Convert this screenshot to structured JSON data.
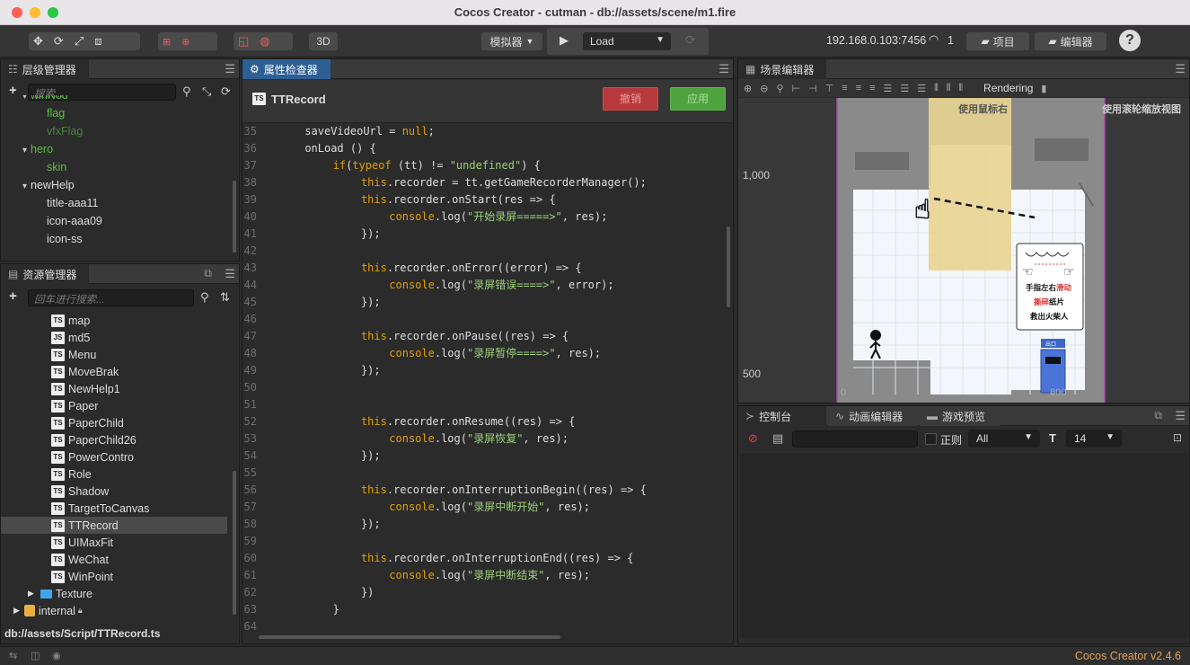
{
  "window": {
    "title": "Cocos Creator - cutman - db://assets/scene/m1.fire"
  },
  "toolbar": {
    "ip": "192.168.0.103:7456",
    "device_count": "1",
    "simulator_label": "模拟器",
    "load_label": "Load",
    "label_3d": "3D",
    "project_label": "项目",
    "editor_label": "编辑器"
  },
  "hierarchy": {
    "tab": "层级管理器",
    "search_placeholder": "搜索...",
    "nodes": [
      {
        "label": "winNod",
        "indent": 1,
        "arrow": true,
        "style": "green"
      },
      {
        "label": "flag",
        "indent": 2,
        "arrow": false,
        "style": "green"
      },
      {
        "label": "vfxFlag",
        "indent": 2,
        "arrow": false,
        "style": "dimgreen"
      },
      {
        "label": "hero",
        "indent": 1,
        "arrow": true,
        "style": "green"
      },
      {
        "label": "skin",
        "indent": 2,
        "arrow": false,
        "style": "green"
      },
      {
        "label": "newHelp",
        "indent": 1,
        "arrow": true,
        "style": "white"
      },
      {
        "label": "title-aaa11",
        "indent": 2,
        "arrow": false,
        "style": "white"
      },
      {
        "label": "icon-aaa09",
        "indent": 2,
        "arrow": false,
        "style": "white"
      },
      {
        "label": "icon-ss",
        "indent": 2,
        "arrow": false,
        "style": "white"
      }
    ]
  },
  "assets": {
    "tab": "资源管理器",
    "search_placeholder": "回车进行搜索...",
    "files": [
      {
        "badge": "TS",
        "name": "map"
      },
      {
        "badge": "JS",
        "name": "md5"
      },
      {
        "badge": "TS",
        "name": "Menu"
      },
      {
        "badge": "TS",
        "name": "MoveBrak"
      },
      {
        "badge": "TS",
        "name": "NewHelp1"
      },
      {
        "badge": "TS",
        "name": "Paper"
      },
      {
        "badge": "TS",
        "name": "PaperChild"
      },
      {
        "badge": "TS",
        "name": "PaperChild26"
      },
      {
        "badge": "TS",
        "name": "PowerContro"
      },
      {
        "badge": "TS",
        "name": "Role"
      },
      {
        "badge": "TS",
        "name": "Shadow"
      },
      {
        "badge": "TS",
        "name": "TargetToCanvas"
      },
      {
        "badge": "TS",
        "name": "TTRecord"
      },
      {
        "badge": "TS",
        "name": "UIMaxFit"
      },
      {
        "badge": "TS",
        "name": "WeChat"
      },
      {
        "badge": "TS",
        "name": "WinPoint"
      }
    ],
    "texture_folder": "Texture",
    "internal_folder": "internal",
    "path": "db://assets/Script/TTRecord.ts"
  },
  "inspector": {
    "tab": "属性检查器",
    "file_name": "TTRecord",
    "revert_label": "撤销",
    "apply_label": "应用",
    "lines": [
      {
        "n": "35",
        "indent": 4,
        "parts": [
          [
            "fn",
            "saveVideoUrl = "
          ],
          [
            "nul",
            "null"
          ],
          [
            "fn",
            ";"
          ]
        ]
      },
      {
        "n": "36",
        "indent": 4,
        "parts": [
          [
            "fn",
            "onLoad () {"
          ]
        ]
      },
      {
        "n": "37",
        "indent": 8,
        "parts": [
          [
            "kw",
            "if"
          ],
          [
            "fn",
            "("
          ],
          [
            "kw",
            "typeof"
          ],
          [
            "fn",
            " (tt) != "
          ],
          [
            "str",
            "\"undefined\""
          ],
          [
            "fn",
            ") {"
          ]
        ]
      },
      {
        "n": "38",
        "indent": 12,
        "parts": [
          [
            "kw",
            "this"
          ],
          [
            "fn",
            ".recorder = tt.getGameRecorderManager();"
          ]
        ]
      },
      {
        "n": "39",
        "indent": 12,
        "parts": [
          [
            "kw",
            "this"
          ],
          [
            "fn",
            ".recorder.onStart(res => {"
          ]
        ]
      },
      {
        "n": "40",
        "indent": 16,
        "parts": [
          [
            "kw",
            "console"
          ],
          [
            "fn",
            ".log("
          ],
          [
            "str",
            "\"开始录屏=====>\""
          ],
          [
            "fn",
            ", res);"
          ]
        ]
      },
      {
        "n": "41",
        "indent": 12,
        "parts": [
          [
            "fn",
            "});"
          ]
        ]
      },
      {
        "n": "42",
        "indent": 0,
        "parts": []
      },
      {
        "n": "43",
        "indent": 12,
        "parts": [
          [
            "kw",
            "this"
          ],
          [
            "fn",
            ".recorder.onError((error) => {"
          ]
        ]
      },
      {
        "n": "44",
        "indent": 16,
        "parts": [
          [
            "kw",
            "console"
          ],
          [
            "fn",
            ".log("
          ],
          [
            "str",
            "\"录屏错误====>\""
          ],
          [
            "fn",
            ", error);"
          ]
        ]
      },
      {
        "n": "45",
        "indent": 12,
        "parts": [
          [
            "fn",
            "});"
          ]
        ]
      },
      {
        "n": "46",
        "indent": 0,
        "parts": []
      },
      {
        "n": "47",
        "indent": 12,
        "parts": [
          [
            "kw",
            "this"
          ],
          [
            "fn",
            ".recorder.onPause((res) => {"
          ]
        ]
      },
      {
        "n": "48",
        "indent": 16,
        "parts": [
          [
            "kw",
            "console"
          ],
          [
            "fn",
            ".log("
          ],
          [
            "str",
            "\"录屏暂停====>\""
          ],
          [
            "fn",
            ", res);"
          ]
        ]
      },
      {
        "n": "49",
        "indent": 12,
        "parts": [
          [
            "fn",
            "});"
          ]
        ]
      },
      {
        "n": "50",
        "indent": 0,
        "parts": []
      },
      {
        "n": "51",
        "indent": 0,
        "parts": []
      },
      {
        "n": "52",
        "indent": 12,
        "parts": [
          [
            "kw",
            "this"
          ],
          [
            "fn",
            ".recorder.onResume((res) => {"
          ]
        ]
      },
      {
        "n": "53",
        "indent": 16,
        "parts": [
          [
            "kw",
            "console"
          ],
          [
            "fn",
            ".log("
          ],
          [
            "str",
            "\"录屏恢复\""
          ],
          [
            "fn",
            ", res);"
          ]
        ]
      },
      {
        "n": "54",
        "indent": 12,
        "parts": [
          [
            "fn",
            "});"
          ]
        ]
      },
      {
        "n": "55",
        "indent": 0,
        "parts": []
      },
      {
        "n": "56",
        "indent": 12,
        "parts": [
          [
            "kw",
            "this"
          ],
          [
            "fn",
            ".recorder.onInterruptionBegin((res) => {"
          ]
        ]
      },
      {
        "n": "57",
        "indent": 16,
        "parts": [
          [
            "kw",
            "console"
          ],
          [
            "fn",
            ".log("
          ],
          [
            "str",
            "\"录屏中断开始\""
          ],
          [
            "fn",
            ", res);"
          ]
        ]
      },
      {
        "n": "58",
        "indent": 12,
        "parts": [
          [
            "fn",
            "});"
          ]
        ]
      },
      {
        "n": "59",
        "indent": 0,
        "parts": []
      },
      {
        "n": "60",
        "indent": 12,
        "parts": [
          [
            "kw",
            "this"
          ],
          [
            "fn",
            ".recorder.onInterruptionEnd((res) => {"
          ]
        ]
      },
      {
        "n": "61",
        "indent": 16,
        "parts": [
          [
            "kw",
            "console"
          ],
          [
            "fn",
            ".log("
          ],
          [
            "str",
            "\"录屏中断结束\""
          ],
          [
            "fn",
            ", res);"
          ]
        ]
      },
      {
        "n": "62",
        "indent": 12,
        "parts": [
          [
            "fn",
            "})"
          ]
        ]
      },
      {
        "n": "63",
        "indent": 8,
        "parts": [
          [
            "fn",
            "}"
          ]
        ]
      },
      {
        "n": "64",
        "indent": 0,
        "parts": []
      }
    ]
  },
  "scene": {
    "tab": "场景编辑器",
    "rendering_label": "Rendering",
    "hint_mouse": "使用鼠标右",
    "hint_wheel": "使用滚轮缩放视图",
    "axis_1000": "1,000",
    "axis_500": "500",
    "axis_0": "0",
    "axis_800": "800",
    "tip_line1_a": "手指左右",
    "tip_line1_b": "滑动",
    "tip_line2_a": "撕碎",
    "tip_line2_b": "纸片",
    "tip_line3": "救出火柴人",
    "door_label": "出口"
  },
  "console": {
    "tab_console": "控制台",
    "tab_animation": "动画编辑器",
    "tab_preview": "游戏预览",
    "regex_label": "正则",
    "filter_value": "All",
    "font_size": "14"
  },
  "footer": {
    "version": "Cocos Creator v2.4.6"
  }
}
